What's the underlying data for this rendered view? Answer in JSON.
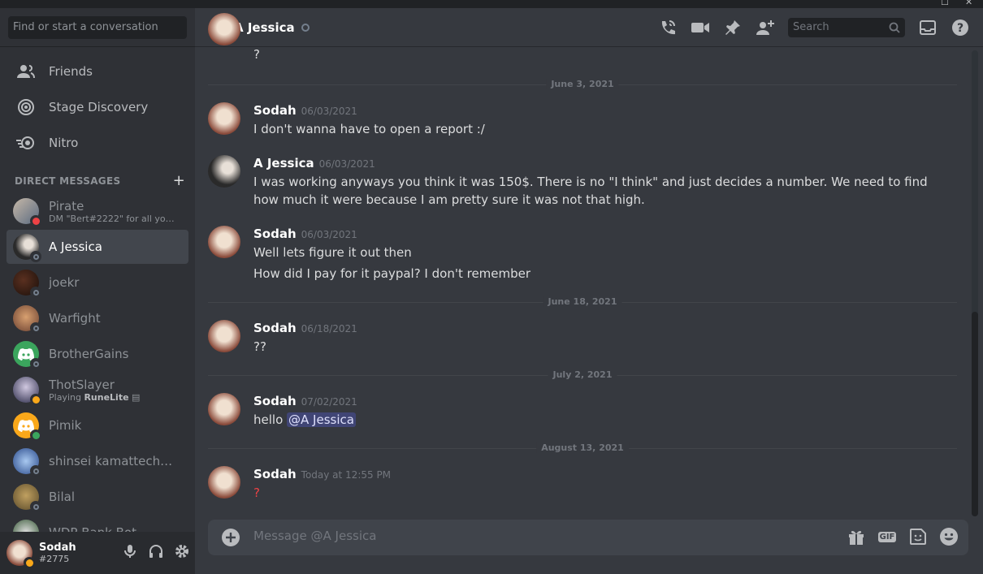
{
  "window": {
    "maximize_glyph": "☐",
    "close_glyph": "✕"
  },
  "sidebar": {
    "search_placeholder": "Find or start a conversation",
    "nav": [
      {
        "label": "Friends",
        "icon": "friends-icon"
      },
      {
        "label": "Stage Discovery",
        "icon": "stage-icon"
      },
      {
        "label": "Nitro",
        "icon": "nitro-icon"
      }
    ],
    "dm_header": "DIRECT MESSAGES",
    "dm_add": "+",
    "dms": [
      {
        "name": "Pirate",
        "sub": "DM \"Bert#2222\" for all your ...",
        "status": "dnd"
      },
      {
        "name": "A Jessica",
        "sub": "",
        "status": "offline",
        "active": true
      },
      {
        "name": "joekr",
        "sub": "",
        "status": "offline"
      },
      {
        "name": "Warfight",
        "sub": "",
        "status": "offline"
      },
      {
        "name": "BrotherGains",
        "sub": "",
        "status": "offline"
      },
      {
        "name": "ThotSlayer",
        "sub_prefix": "Playing ",
        "sub_bold": "RuneLite",
        "status": "idle"
      },
      {
        "name": "Pimik",
        "sub": "",
        "status": "online"
      },
      {
        "name": "shinsei kamattechan ...",
        "sub": "",
        "status": "offline"
      },
      {
        "name": "Bilal",
        "sub": "",
        "status": "offline"
      },
      {
        "name": "WDP Bank Bot",
        "sub": "",
        "status": "offline"
      }
    ],
    "user": {
      "name": "Sodah",
      "tag": "#2775"
    }
  },
  "header": {
    "title": "A Jessica",
    "search_placeholder": "Search"
  },
  "chat": {
    "partial_top": "?",
    "dividers": [
      "June 3, 2021",
      "June 18, 2021",
      "July 2, 2021",
      "August 13, 2021"
    ],
    "messages": [
      {
        "author": "Sodah",
        "time": "06/03/2021",
        "lines": [
          "I don't wanna have to open a report :/"
        ]
      },
      {
        "author": "A Jessica",
        "time": "06/03/2021",
        "lines": [
          "I was working anyways you think it was 150$. There is no \"I think\" and just decides a number. We need to find how much it were because I am pretty sure it was not that high."
        ]
      },
      {
        "author": "Sodah",
        "time": "06/03/2021",
        "lines": [
          "Well lets figure it out then",
          "How did I pay for it paypal? I don't remember"
        ]
      },
      {
        "author": "Sodah",
        "time": "06/18/2021",
        "lines": [
          "??"
        ]
      },
      {
        "author": "Sodah",
        "time": "07/02/2021",
        "text": "hello ",
        "mention": "@A Jessica"
      },
      {
        "author": "Sodah",
        "time": "Today at 12:55 PM",
        "lines": [
          "?"
        ],
        "red": true
      }
    ]
  },
  "composer": {
    "placeholder": "Message @A Jessica",
    "gif_label": "GIF"
  },
  "colors": {
    "accent": "#5865f2",
    "online": "#3ba55d",
    "dnd": "#ed4245",
    "idle": "#faa81a"
  }
}
